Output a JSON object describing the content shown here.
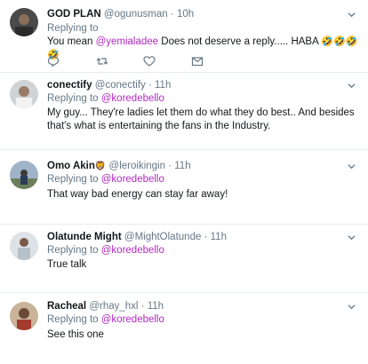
{
  "tweets": [
    {
      "name": "GOD PLAN",
      "handle": "@ogunusman",
      "time": "10h",
      "reply_prefix": "Replying to",
      "reply_to": "",
      "text_prefix": "You mean ",
      "text_mention": "@yemialadee",
      "text_suffix": " Does not deserve a reply..... HABA ",
      "emoji": "🤣🤣🤣🤣"
    },
    {
      "name": "conectify",
      "handle": "@conectify",
      "time": "11h",
      "reply_prefix": "Replying to",
      "reply_to": "@koredebello",
      "text": "My guy...  They're ladies let them do what they do best..  And besides that's what is entertaining the fans in the Industry."
    },
    {
      "name": "Omo Akin",
      "name_emoji": "🦁",
      "handle": "@leroikingin",
      "time": "11h",
      "reply_prefix": "Replying to",
      "reply_to": "@koredebello",
      "text": "That way bad energy can stay far away!"
    },
    {
      "name": "Olatunde Might",
      "handle": "@MightOlatunde",
      "time": "11h",
      "reply_prefix": "Replying to",
      "reply_to": "@koredebello",
      "text": "True talk"
    },
    {
      "name": "Racheal",
      "handle": "@rhay_hxl",
      "time": "11h",
      "reply_prefix": "Replying to",
      "reply_to": "@koredebello",
      "text": "See this one"
    }
  ],
  "separator": "·",
  "icons": {
    "reply": "reply-icon",
    "retweet": "retweet-icon",
    "like": "heart-icon",
    "message": "direct-message-icon",
    "menu": "chevron-down-icon"
  },
  "colors": {
    "mention": "#b02bbf",
    "muted": "#657786",
    "divider": "#e6ecf0"
  }
}
